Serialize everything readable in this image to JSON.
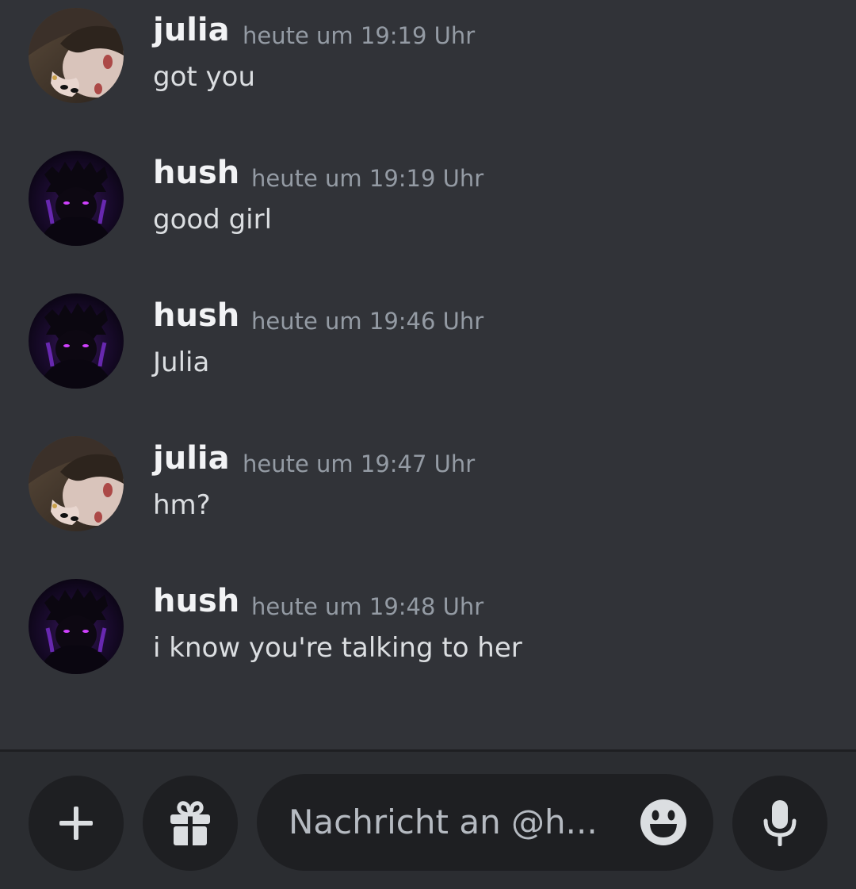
{
  "channel": {
    "recipient": "@hush"
  },
  "messages": [
    {
      "author": "julia",
      "timestamp": "heute um 19:19 Uhr",
      "content": "got you",
      "avatar": "julia-avatar"
    },
    {
      "author": "hush",
      "timestamp": "heute um 19:19 Uhr",
      "content": "good girl",
      "avatar": "hush-avatar"
    },
    {
      "author": "hush",
      "timestamp": "heute um 19:46 Uhr",
      "content": "Julia",
      "avatar": "hush-avatar"
    },
    {
      "author": "julia",
      "timestamp": "heute um 19:47 Uhr",
      "content": "hm?",
      "avatar": "julia-avatar"
    },
    {
      "author": "hush",
      "timestamp": "heute um 19:48 Uhr",
      "content": "i know you're talking to her",
      "avatar": "hush-avatar"
    }
  ],
  "composer": {
    "placeholder": "Nachricht an @h...",
    "buttons": {
      "add": "plus-icon",
      "gift": "gift-icon",
      "emoji": "smile-emoji-icon",
      "voice": "microphone-icon"
    }
  },
  "colors": {
    "background": "#313338",
    "composer_background": "#2b2d31",
    "button_background": "#1e1f22",
    "author": "#f2f3f5",
    "message_text": "#dbdee1",
    "timestamp": "#949ba4",
    "hush_accent": "#8a2be2"
  }
}
